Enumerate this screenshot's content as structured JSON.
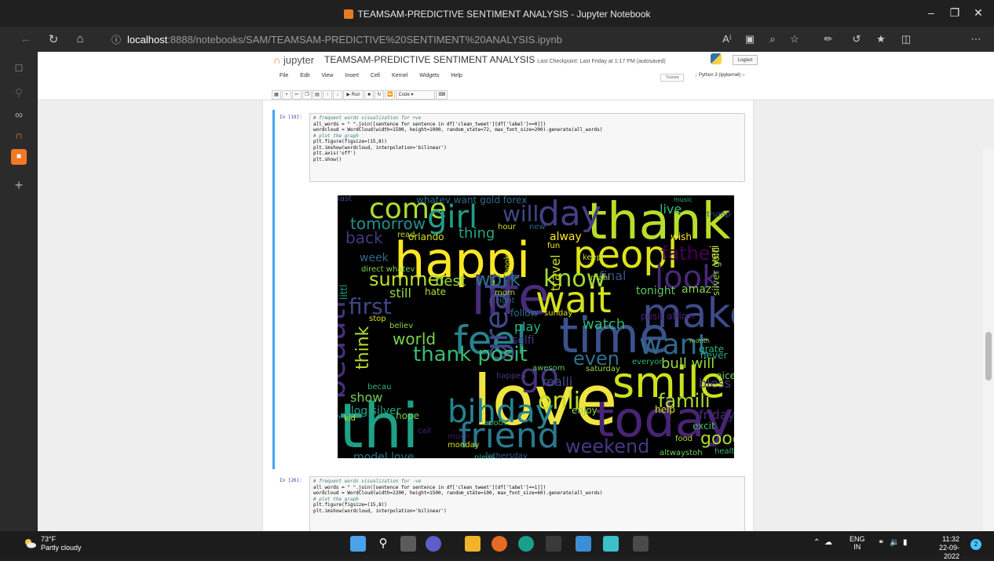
{
  "window": {
    "title": "TEAMSAM-PREDICTIVE SENTIMENT ANALYSIS - Jupyter Notebook"
  },
  "browser": {
    "url_host": "localhost",
    "url_path": ":8888/notebooks/SAM/TEAMSAM-PREDICTIVE%20SENTIMENT%20ANALYSIS.ipynb"
  },
  "jupyter": {
    "logo_text": "jupyter",
    "notebook_title": "TEAMSAM-PREDICTIVE SENTIMENT ANALYSIS",
    "checkpoint": "Last Checkpoint: Last Friday at 1:17 PM  (autosaved)",
    "logout": "Logout",
    "menu": [
      "File",
      "Edit",
      "View",
      "Insert",
      "Cell",
      "Kernel",
      "Widgets",
      "Help"
    ],
    "trusted": "Trusted",
    "kernel": "Python 3 (ipykernel)",
    "toolbar": {
      "run": "Run",
      "cell_type": "Code"
    }
  },
  "cell1": {
    "prompt": "In [19]:",
    "lines": [
      "# frequent words visualization for +ve",
      "all_words = \" \".join([sentence for sentence in df['clean_tweet'][df['label']==0]])",
      "",
      "wordcloud = WordCloud(width=1500, height=1000, random_state=72, max_font_size=200).generate(all_words)",
      "",
      "# plot the graph",
      "plt.figure(figsize=(15,8))",
      "plt.imshow(wordcloud, interpolation='bilinear')",
      "plt.axis('off')",
      "plt.show()"
    ]
  },
  "wordcloud": [
    {
      "t": "love",
      "c": "#f0e442"
    },
    {
      "t": "happi",
      "c": "#fde725"
    },
    {
      "t": "life",
      "c": "#472c7a"
    },
    {
      "t": "thank",
      "c": "#b8de29"
    },
    {
      "t": "time",
      "c": "#3b528b"
    },
    {
      "t": "thi",
      "c": "#1fa187"
    },
    {
      "t": "today",
      "c": "#482475"
    },
    {
      "t": "smile",
      "c": "#cde11d"
    },
    {
      "t": "peopl",
      "c": "#dde318"
    },
    {
      "t": "make",
      "c": "#3e4a89"
    },
    {
      "t": "wait",
      "c": "#d5e21a"
    },
    {
      "t": "feel",
      "c": "#26828e"
    },
    {
      "t": "friend",
      "c": "#2a788e"
    },
    {
      "t": "day",
      "c": "#433e85"
    },
    {
      "t": "go",
      "c": "#46337e"
    },
    {
      "t": "come",
      "c": "#aadc32"
    },
    {
      "t": "girl",
      "c": "#1f9e89"
    },
    {
      "t": "bihday",
      "c": "#25848e"
    },
    {
      "t": "look",
      "c": "#482878"
    },
    {
      "t": "great",
      "c": "#3f4788"
    },
    {
      "t": "beauti",
      "c": "#472f7d"
    },
    {
      "t": "want",
      "c": "#31688e"
    },
    {
      "t": "thank posit",
      "c": "#3bbb75"
    },
    {
      "t": "onli",
      "c": "#c2df23"
    },
    {
      "t": "famili",
      "c": "#addc30"
    },
    {
      "t": "weekend",
      "c": "#443a83"
    },
    {
      "t": "know",
      "c": "#a2da37"
    },
    {
      "t": "summer",
      "c": "#bddf26"
    },
    {
      "t": "work",
      "c": "#2c738e"
    },
    {
      "t": "tomorrow",
      "c": "#21918c"
    },
    {
      "t": "watch",
      "c": "#35b779"
    },
    {
      "t": "even",
      "c": "#2c728e"
    },
    {
      "t": "think",
      "c": "#b5de2b"
    },
    {
      "t": "father",
      "c": "#440154"
    },
    {
      "t": "good",
      "c": "#aadc32"
    },
    {
      "t": "bull will",
      "c": "#9bd93c"
    },
    {
      "t": "back",
      "c": "#443983"
    },
    {
      "t": "world",
      "c": "#7ad151"
    },
    {
      "t": "will",
      "c": "#3e4989"
    },
    {
      "t": "first",
      "c": "#404688"
    },
    {
      "t": "live",
      "c": "#38b977"
    },
    {
      "t": "tonight",
      "c": "#5ec962"
    },
    {
      "t": "amaz",
      "c": "#84d44b"
    },
    {
      "t": "posit affirm",
      "c": "#481f70"
    },
    {
      "t": "sunday",
      "c": "#e5e419"
    },
    {
      "t": "play",
      "c": "#29af7f"
    },
    {
      "t": "selfi",
      "c": "#453882"
    },
    {
      "t": "follow",
      "c": "#2d708e"
    },
    {
      "t": "best",
      "c": "#90d743"
    },
    {
      "t": "still",
      "c": "#95d840"
    },
    {
      "t": "hate",
      "c": "#b0dd2f"
    },
    {
      "t": "alway",
      "c": "#fde725"
    },
    {
      "t": "orlando",
      "c": "#d0e11c"
    },
    {
      "t": "thing",
      "c": "#22a884"
    },
    {
      "t": "week",
      "c": "#31688e"
    },
    {
      "t": "littl",
      "c": "#1fa088"
    },
    {
      "t": "direct whatev",
      "c": "#7fd34e"
    },
    {
      "t": "final",
      "c": "#3b528b"
    },
    {
      "t": "show",
      "c": "#70cf57"
    },
    {
      "t": "blog silver",
      "c": "#22a785"
    },
    {
      "t": "hope",
      "c": "#75d054"
    },
    {
      "t": "kid",
      "c": "#c8e020"
    },
    {
      "t": "enjoy",
      "c": "#8ed645"
    },
    {
      "t": "help",
      "c": "#d8e219"
    },
    {
      "t": "model love",
      "c": "#2a768e"
    },
    {
      "t": "fathersday",
      "c": "#355f8d"
    },
    {
      "t": "year",
      "c": "#3d4e8a"
    },
    {
      "t": "realli",
      "c": "#3e4c8a"
    },
    {
      "t": "awesom",
      "c": "#5cc863"
    },
    {
      "t": "bless",
      "c": "#433d84"
    },
    {
      "t": "nice",
      "c": "#7ad151"
    },
    {
      "t": "excit",
      "c": "#4ac16d"
    },
    {
      "t": "friday",
      "c": "#472a7a"
    },
    {
      "t": "healthi",
      "c": "#35b779"
    },
    {
      "t": "altwaystoh",
      "c": "#6ece58"
    },
    {
      "t": "food",
      "c": "#b2dd2d"
    },
    {
      "t": "month",
      "c": "#87d549"
    },
    {
      "t": "never",
      "c": "#26ad81"
    },
    {
      "t": "grate",
      "c": "#29af7f"
    },
    {
      "t": "whatev want gold forex",
      "c": "#2f6c8e"
    },
    {
      "t": "silver gold",
      "c": "#95d840"
    },
    {
      "t": "wish",
      "c": "#fde725"
    },
    {
      "t": "veri",
      "c": "#c5e021"
    },
    {
      "t": "fun",
      "c": "#fde725"
    },
    {
      "t": "keep",
      "c": "#c2df23"
    },
    {
      "t": "travel",
      "c": "#d0e11c"
    },
    {
      "t": "new",
      "c": "#33628d"
    },
    {
      "t": "hour",
      "c": "#d5e21a"
    },
    {
      "t": "right",
      "c": "#2f6b8e"
    },
    {
      "t": "morn",
      "c": "#a8db34"
    },
    {
      "t": "read",
      "c": "#b5de2b"
    },
    {
      "t": "stop",
      "c": "#d8e219"
    },
    {
      "t": "believ",
      "c": "#8bd646"
    },
    {
      "t": "everyon",
      "c": "#31b57b"
    },
    {
      "t": "saturday",
      "c": "#9dd93b"
    },
    {
      "t": "anoth",
      "c": "#44bf70"
    },
    {
      "t": "call",
      "c": "#482071"
    },
    {
      "t": "much",
      "c": "#481769"
    },
    {
      "t": "monday",
      "c": "#d2e21b"
    },
    {
      "t": "pleas",
      "c": "#25ab82"
    },
    {
      "t": "becau",
      "c": "#31b57b"
    },
    {
      "t": "book",
      "c": "#cde11d"
    },
    {
      "t": "happen",
      "c": "#463480"
    },
    {
      "t": "mani",
      "c": "#9bd93c"
    },
    {
      "t": "made",
      "c": "#404688"
    },
    {
      "t": "music",
      "c": "#31b57b"
    },
    {
      "t": "trump",
      "c": "#39558c"
    },
    {
      "t": "last",
      "c": "#3e4a89"
    }
  ],
  "cell2": {
    "prompt": "In [26]:",
    "lines": [
      "# frequent words visualization for -ve",
      "all_words = \" \".join([sentence for sentence in df['clean_tweet'][df['label']==1]])",
      "",
      "wordcloud = WordCloud(width=2200, height=1500, random_state=100, max_font_size=60).generate(all_words)",
      "",
      "# plot the graph",
      "plt.figure(figsize=(15,8))",
      "plt.imshow(wordcloud, interpolation='bilinear')"
    ]
  },
  "taskbar": {
    "temp": "73°F",
    "weather": "Partly cloudy",
    "lang1": "ENG",
    "lang2": "IN",
    "time": "11:32",
    "date": "22-09-2022",
    "notif": "2"
  }
}
